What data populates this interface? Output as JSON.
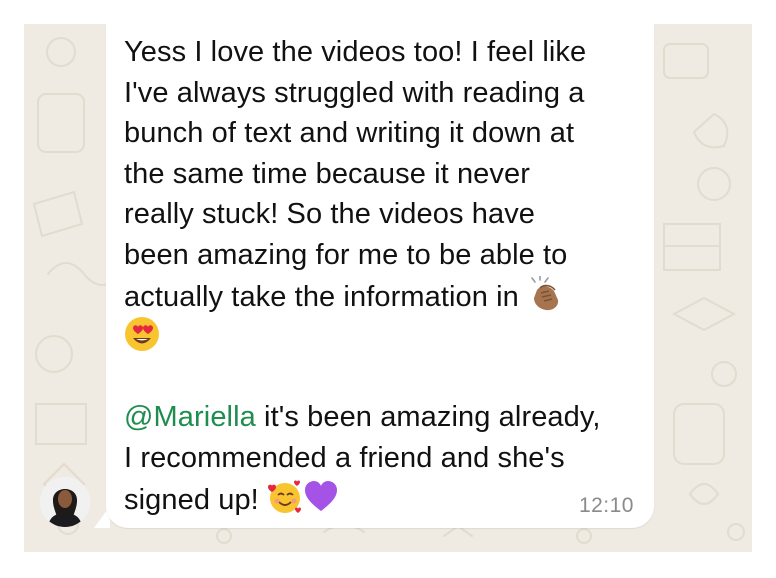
{
  "message": {
    "lines": [
      "Yess I love the videos too! I feel like",
      "I've always struggled with reading a",
      "bunch of text and writing it down at",
      "the same time because it never",
      "really stuck! So the videos have",
      "been amazing for me to be able to",
      "actually take the information in"
    ],
    "mention": "@Mariella",
    "reply_line_1_rest": " it's been amazing already,",
    "reply_line_2": "I recommended a friend and she's",
    "reply_line_3": "signed up!",
    "emojis": [
      "clapping-hands",
      "heart-eyes",
      "smiling-face-with-hearts",
      "purple-heart"
    ],
    "timestamp": "12:10"
  },
  "colors": {
    "wallpaper": "#efeae2",
    "bubble": "#ffffff",
    "mention": "#1f8d4f",
    "timestamp": "#8a8a8a"
  }
}
